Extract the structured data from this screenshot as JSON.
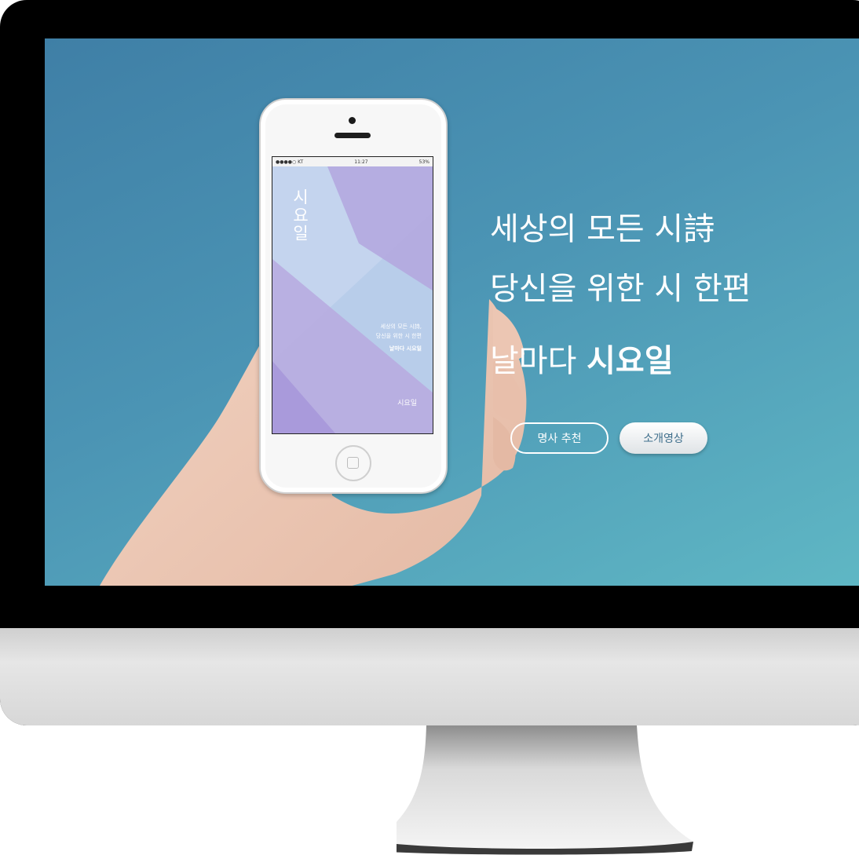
{
  "phone_app": {
    "status_left": "●●●●○ KT",
    "status_time": "11:27",
    "status_right": "53%",
    "title": "시요일",
    "caption_line1": "세상의 모든 시詩,",
    "caption_line2": "당신을 위한 시 한편",
    "caption_line3": "날마다 시요일",
    "logo_text": "시요일"
  },
  "hero": {
    "line1": "세상의 모든 시詩",
    "line2": "당신을 위한 시 한편",
    "line3_regular": "날마다 ",
    "line3_bold": "시요일"
  },
  "buttons": {
    "recommend_label": "명사 추천",
    "intro_video_label": "소개영상"
  },
  "colors": {
    "screen_gradient_start": "#3f7fa6",
    "screen_gradient_end": "#5fb7c4",
    "monitor_frame": "#000000",
    "phone_gradient_light": "#b7c8e8",
    "phone_gradient_purple": "#b3a4dd"
  }
}
